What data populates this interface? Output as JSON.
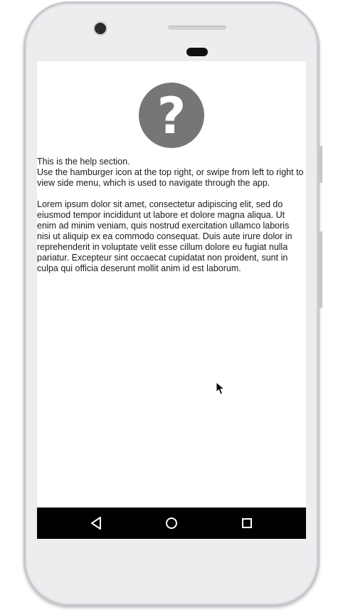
{
  "help": {
    "icon": "help-circle-icon",
    "title": "This is the help section.",
    "instructions": " Use the hamburger icon at the top right, or swipe from left to right to view side menu, which is used to navigate through the app.",
    "lorem": "Lorem ipsum dolor sit amet, consectetur adipiscing elit, sed do eiusmod tempor incididunt ut labore et dolore magna aliqua. Ut enim ad minim veniam, quis nostrud exercitation ullamco laboris nisi ut aliquip ex ea commodo consequat. Duis aute irure dolor in reprehenderit in voluptate velit esse cillum dolore eu fugiat nulla pariatur. Excepteur sint occaecat cupidatat non proident, sunt in culpa qui officia deserunt mollit anim id est laborum."
  },
  "navbar": {
    "back_icon": "back-triangle-icon",
    "home_icon": "home-circle-icon",
    "recents_icon": "recents-square-icon"
  },
  "colors": {
    "icon_circle": "#767676",
    "navbar_bg": "#000000",
    "phone_frame": "#ededef"
  }
}
